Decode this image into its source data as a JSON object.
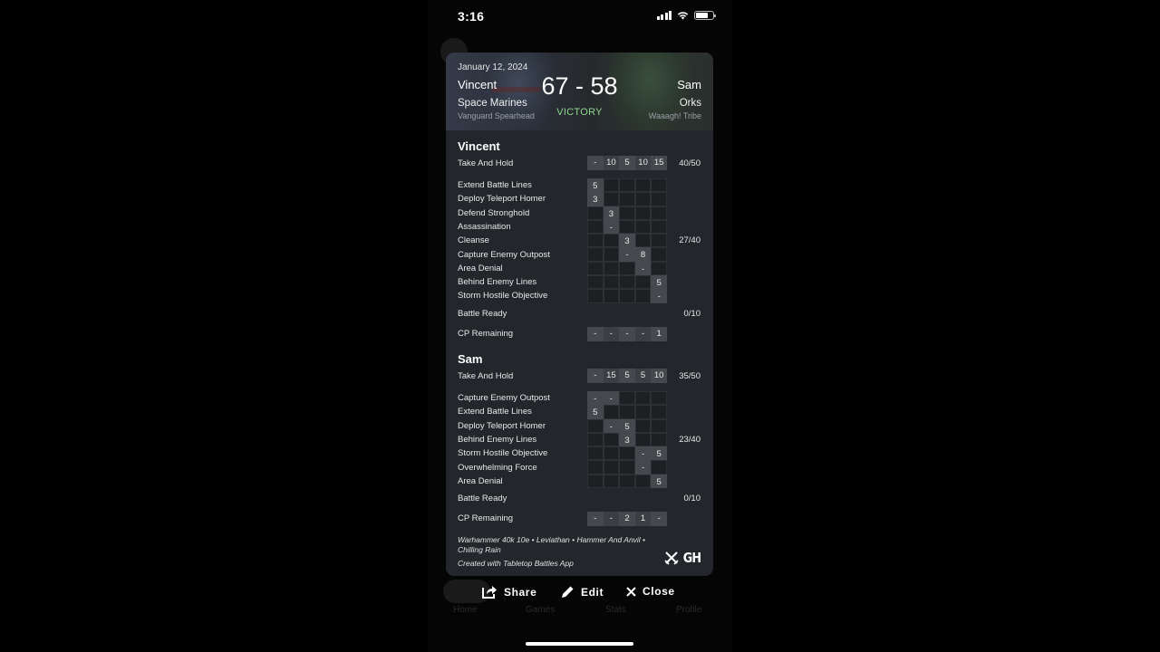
{
  "status_bar": {
    "time": "3:16",
    "icons": [
      "signal-icon",
      "wifi-icon",
      "battery-icon"
    ]
  },
  "game": {
    "date": "January 12, 2024",
    "score": "67 - 58",
    "result": "VICTORY",
    "result_color": "#8fd48f",
    "player1": {
      "name": "Vincent",
      "faction": "Space Marines",
      "detachment": "Vanguard Spearhead"
    },
    "player2": {
      "name": "Sam",
      "faction": "Orks",
      "detachment": "Waaagh! Tribe"
    }
  },
  "players": [
    {
      "name": "Vincent",
      "primary": {
        "label": "Take And Hold",
        "rounds": [
          "-",
          "10",
          "5",
          "10",
          "15"
        ],
        "total": "40/50"
      },
      "secondaries": [
        {
          "label": "Extend Battle Lines",
          "rounds": [
            "5",
            "",
            "",
            "",
            ""
          ]
        },
        {
          "label": "Deploy Teleport Homer",
          "rounds": [
            "3",
            "",
            "",
            "",
            ""
          ]
        },
        {
          "label": "Defend Stronghold",
          "rounds": [
            "",
            "3",
            "",
            "",
            ""
          ]
        },
        {
          "label": "Assassination",
          "rounds": [
            "",
            "-",
            "",
            "",
            ""
          ]
        },
        {
          "label": "Cleanse",
          "rounds": [
            "",
            "",
            "3",
            "",
            ""
          ]
        },
        {
          "label": "Capture Enemy Outpost",
          "rounds": [
            "",
            "",
            "-",
            "8",
            ""
          ]
        },
        {
          "label": "Area Denial",
          "rounds": [
            "",
            "",
            "",
            "-",
            ""
          ]
        },
        {
          "label": "Behind Enemy Lines",
          "rounds": [
            "",
            "",
            "",
            "",
            "5"
          ]
        },
        {
          "label": "Storm Hostile Objective",
          "rounds": [
            "",
            "",
            "",
            "",
            "-"
          ]
        }
      ],
      "secondary_active": [
        [
          1,
          0,
          0,
          0,
          0
        ],
        [
          1,
          0,
          0,
          0,
          0
        ],
        [
          0,
          1,
          0,
          0,
          0
        ],
        [
          0,
          1,
          0,
          0,
          0
        ],
        [
          0,
          0,
          1,
          0,
          0
        ],
        [
          0,
          0,
          1,
          1,
          0
        ],
        [
          0,
          0,
          0,
          1,
          0
        ],
        [
          0,
          0,
          0,
          0,
          1
        ],
        [
          0,
          0,
          0,
          0,
          1
        ]
      ],
      "secondary_total": "27/40",
      "battle_ready": {
        "label": "Battle Ready",
        "total": "0/10"
      },
      "cp": {
        "label": "CP Remaining",
        "rounds": [
          "-",
          "-",
          "-",
          "-",
          "1"
        ]
      }
    },
    {
      "name": "Sam",
      "primary": {
        "label": "Take And Hold",
        "rounds": [
          "-",
          "15",
          "5",
          "5",
          "10"
        ],
        "total": "35/50"
      },
      "secondaries": [
        {
          "label": "Capture Enemy Outpost",
          "rounds": [
            "-",
            "-",
            "",
            "",
            ""
          ]
        },
        {
          "label": "Extend Battle Lines",
          "rounds": [
            "5",
            "",
            "",
            "",
            ""
          ]
        },
        {
          "label": "Deploy Teleport Homer",
          "rounds": [
            "",
            "-",
            "5",
            "",
            ""
          ]
        },
        {
          "label": "Behind Enemy Lines",
          "rounds": [
            "",
            "",
            "3",
            "",
            ""
          ]
        },
        {
          "label": "Storm Hostile Objective",
          "rounds": [
            "",
            "",
            "",
            "-",
            "5"
          ]
        },
        {
          "label": "Overwhelming Force",
          "rounds": [
            "",
            "",
            "",
            "-",
            ""
          ]
        },
        {
          "label": "Area Denial",
          "rounds": [
            "",
            "",
            "",
            "",
            "5"
          ]
        }
      ],
      "secondary_active": [
        [
          1,
          1,
          0,
          0,
          0
        ],
        [
          1,
          0,
          0,
          0,
          0
        ],
        [
          0,
          1,
          1,
          0,
          0
        ],
        [
          0,
          0,
          1,
          0,
          0
        ],
        [
          0,
          0,
          0,
          1,
          1
        ],
        [
          0,
          0,
          0,
          1,
          0
        ],
        [
          0,
          0,
          0,
          0,
          1
        ]
      ],
      "secondary_total": "23/40",
      "battle_ready": {
        "label": "Battle Ready",
        "total": "0/10"
      },
      "cp": {
        "label": "CP Remaining",
        "rounds": [
          "-",
          "-",
          "2",
          "1",
          "-"
        ]
      }
    }
  ],
  "footer": {
    "game_info": "Warhammer 40k 10e • Leviathan • Hammer And Anvil • Chilling Rain",
    "credit": "Created with Tabletop Battles App",
    "logo_text": "GH"
  },
  "actions": {
    "share": "Share",
    "edit": "Edit",
    "close": "Close"
  },
  "background_tabs": [
    "Home",
    "Games",
    "Stats",
    "Profile"
  ]
}
